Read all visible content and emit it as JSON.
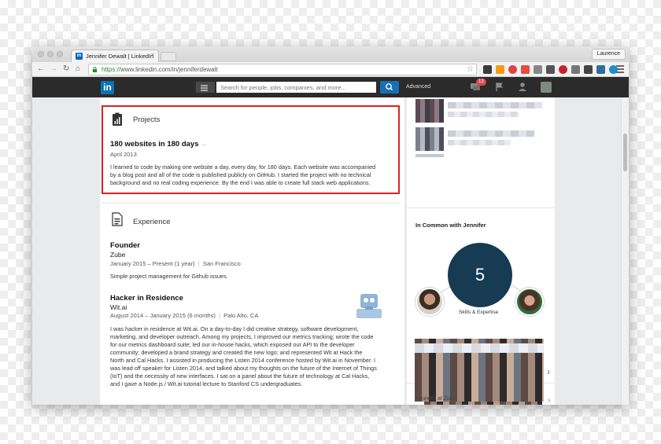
{
  "browser": {
    "tab_title": "Jennifer Dewalt | LinkedIn",
    "tab_close": "×",
    "profile_button": "Laurence",
    "url_scheme": "https://",
    "url_rest": "www.linkedin.com/in/jenniferdewalt"
  },
  "header": {
    "logo": "in",
    "search_placeholder": "Search for people, jobs, companies, and more...",
    "advanced_label": "Advanced",
    "notification_count": "13"
  },
  "projects": {
    "section_title": "Projects",
    "title": "180 websites in 180 days",
    "date": "April 2013",
    "description_lines": [
      "I learned to code by making one website a day, every day, for 180 days. Each website was accompanied",
      "by a blog post and all of the code is published publicly on GitHub. I started the project with no technical",
      "background and no real coding experience. By the end I was able to create full stack web applications."
    ]
  },
  "experience": {
    "section_title": "Experience",
    "jobs": [
      {
        "title": "Founder",
        "company": "Zube",
        "dates": "January 2015 – Present (1 year)",
        "location": "San Francisco",
        "description_lines": [
          "Simple project management for Github issues."
        ]
      },
      {
        "title": "Hacker in Residence",
        "company": "Wit.ai",
        "dates": "August 2014 – January 2015 (6 months)",
        "location": "Palo Alto, CA",
        "description_lines": [
          "I was hacker in residence at Wit.ai. On a day-to-day I did creative strategy, software development,",
          "marketing, and developer outreach. Among my projects, I improved our metrics tracking; wrote the code",
          "for our metrics dashboard suite; led our in-house hacks, which exposed our API to the developer",
          "community; developed a brand strategy and created the new logo; and represented Wit at Hack the",
          "North and Cal Hacks. I assisted in producing the Listen 2014 conference hosted by Wit.ai in November. I",
          "was lead off speaker for Listen 2014, and talked about my thoughts on the future of the Internet of Things",
          "(IoT) and the necessity of new interfaces. I sat on a panel about the future of technology at Cal Hacks,",
          "and I gave a Node.js / Wit.ai tutorial lecture to Stanford CS undergraduates."
        ]
      }
    ]
  },
  "sidebar": {
    "in_common_title": "In Common with Jennifer",
    "shared_count": "5",
    "shared_label": "Skills & Expertise",
    "bottom_caption": "Founder at Zube"
  },
  "colors": {
    "linkedin_blue": "#0a73b1",
    "header_dark": "#2b2b2b",
    "highlight_red": "#e02020",
    "circle_navy": "#163b53"
  }
}
